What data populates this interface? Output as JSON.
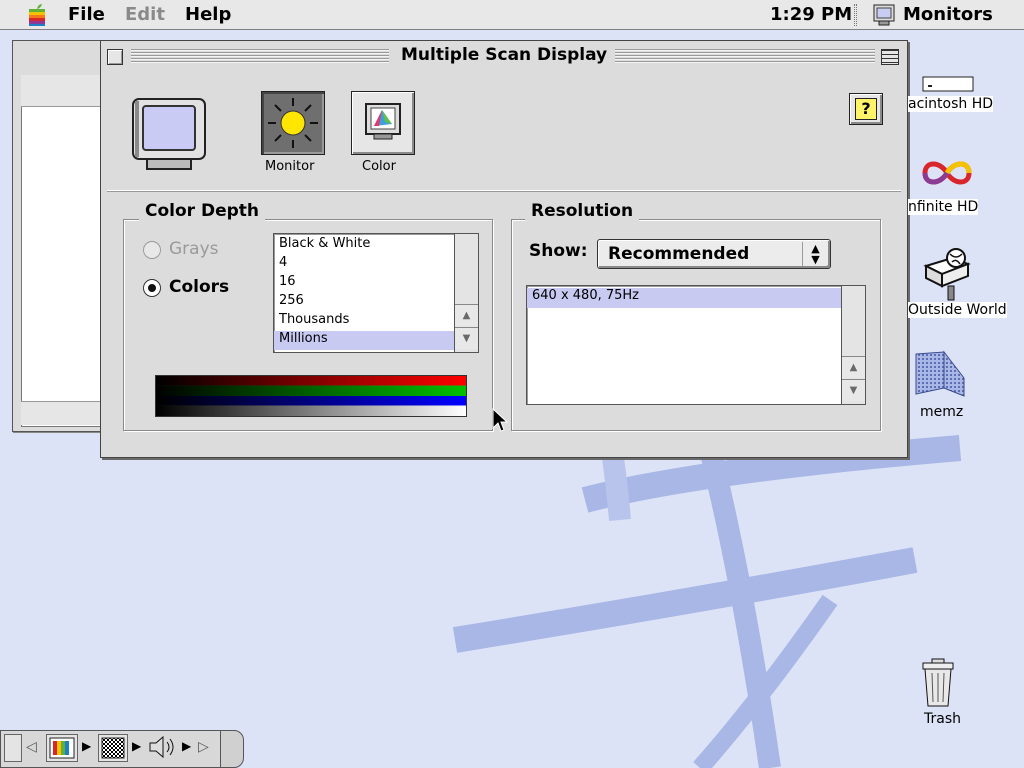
{
  "menubar": {
    "apple_icon": "apple-logo",
    "file": "File",
    "edit": "Edit",
    "help": "Help",
    "clock": "1:29 PM",
    "app_name": "Monitors",
    "app_icon": "monitor-icon"
  },
  "window": {
    "title": "Multiple Scan Display",
    "toolbar": {
      "monitor_label": "Monitor",
      "color_label": "Color",
      "help_label": "?"
    },
    "color_depth": {
      "title": "Color Depth",
      "grays_label": "Grays",
      "colors_label": "Colors",
      "selected_mode": "Colors",
      "options": [
        "Black & White",
        "4",
        "16",
        "256",
        "Thousands",
        "Millions"
      ],
      "selected_option": "Millions"
    },
    "resolution": {
      "title": "Resolution",
      "show_label": "Show:",
      "show_value": "Recommended",
      "options": [
        "640 x 480, 75Hz"
      ],
      "selected_option": "640 x 480, 75Hz"
    }
  },
  "desktop": {
    "icons": [
      {
        "label": "acintosh HD",
        "icon": "hard-disk-icon"
      },
      {
        "label": "nfinite HD",
        "icon": "infinity-disk-icon"
      },
      {
        "label": "Outside World",
        "icon": "outside-world-icon"
      },
      {
        "label": "memz",
        "icon": "folder-icon"
      },
      {
        "label": "Trash",
        "icon": "trash-icon"
      }
    ]
  },
  "colors": {
    "desktop": "#dde3f6",
    "desktop_art": "#a9b7e6",
    "selection": "#c8caf2",
    "help_yellow": "#fff36a"
  }
}
